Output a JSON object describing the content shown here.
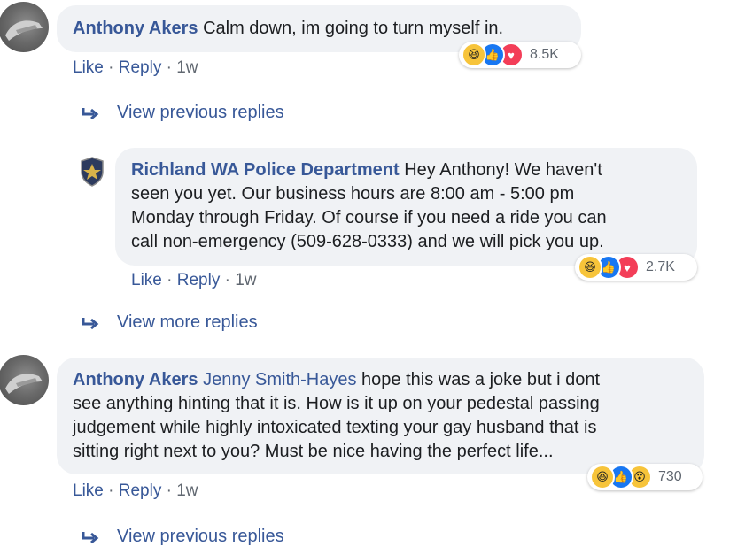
{
  "comments": [
    {
      "author": "Anthony Akers",
      "text": "Calm down, im going to turn myself in.",
      "reactions_count": "8.5K",
      "reactions": [
        "haha-icon",
        "like-icon",
        "love-icon"
      ],
      "actions": {
        "like": "Like",
        "sep1": " · ",
        "reply": "Reply",
        "sep2": " · ",
        "time": "1w"
      }
    },
    {
      "author": "Richland WA Police Department",
      "lines": [
        " Hey Anthony! We haven't",
        "seen you yet. Our business hours are 8:00 am - 5:00 pm",
        "Monday through Friday. Of course if you need a ride you can",
        "call non-emergency (509-628-0333) and we will pick you up."
      ],
      "reactions_count": "2.7K",
      "reactions": [
        "haha-icon",
        "like-icon",
        "love-icon"
      ],
      "actions": {
        "like": "Like",
        "sep1": " · ",
        "reply": "Reply",
        "sep2": " · ",
        "time": "1w"
      }
    },
    {
      "author": "Anthony Akers",
      "tagged": "Jenny Smith-Hayes",
      "lines": [
        " hope this was a joke but i dont",
        "see anything hinting that it is. How is it up on your pedestal passing",
        "judgement while highly intoxicated texting your gay husband that is",
        "sitting right next to you? Must be nice having the perfect life..."
      ],
      "reactions_count": "730",
      "reactions": [
        "haha-icon",
        "like-icon",
        "wow-icon"
      ],
      "actions": {
        "like": "Like",
        "sep1": " · ",
        "reply": "Reply",
        "sep2": " · ",
        "time": "1w"
      }
    }
  ],
  "view_links": {
    "first": "View previous replies",
    "second": "View more replies",
    "third": "View previous replies"
  },
  "colors": {
    "link": "#385898",
    "bubble": "#f0f2f5",
    "meta": "#606770"
  }
}
